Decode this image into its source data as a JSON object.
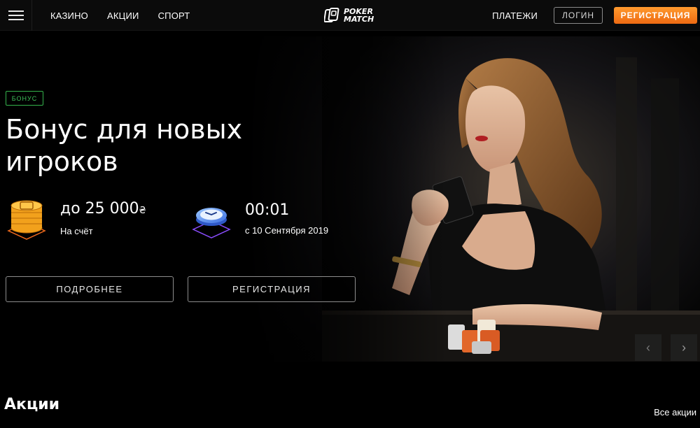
{
  "header": {
    "nav": [
      "КАЗИНО",
      "АКЦИИ",
      "СПОРТ"
    ],
    "logo_line1": "POKER",
    "logo_line2": "MATCH",
    "payments": "ПЛАТЕЖИ",
    "login": "ЛОГИН",
    "register": "РЕГИСТРАЦИЯ"
  },
  "hero": {
    "badge": "БОНУС",
    "title_line1": "Бонус для новых",
    "title_line2": "игроков",
    "bonus_value": "до 25 000",
    "currency": "₴",
    "bonus_label": "На счёт",
    "time_value": "00:01",
    "time_label": "с 10 Сентября 2019",
    "details_button": "ПОДРОБНЕЕ",
    "register_button": "РЕГИСТРАЦИЯ",
    "prev_icon": "chevron-left-icon",
    "next_icon": "chevron-right-icon"
  },
  "promos": {
    "title": "Акции",
    "all_link": "Все акции"
  },
  "colors": {
    "accent_orange": "#f07a1c",
    "badge_green": "#3fc15a",
    "background": "#000000"
  }
}
